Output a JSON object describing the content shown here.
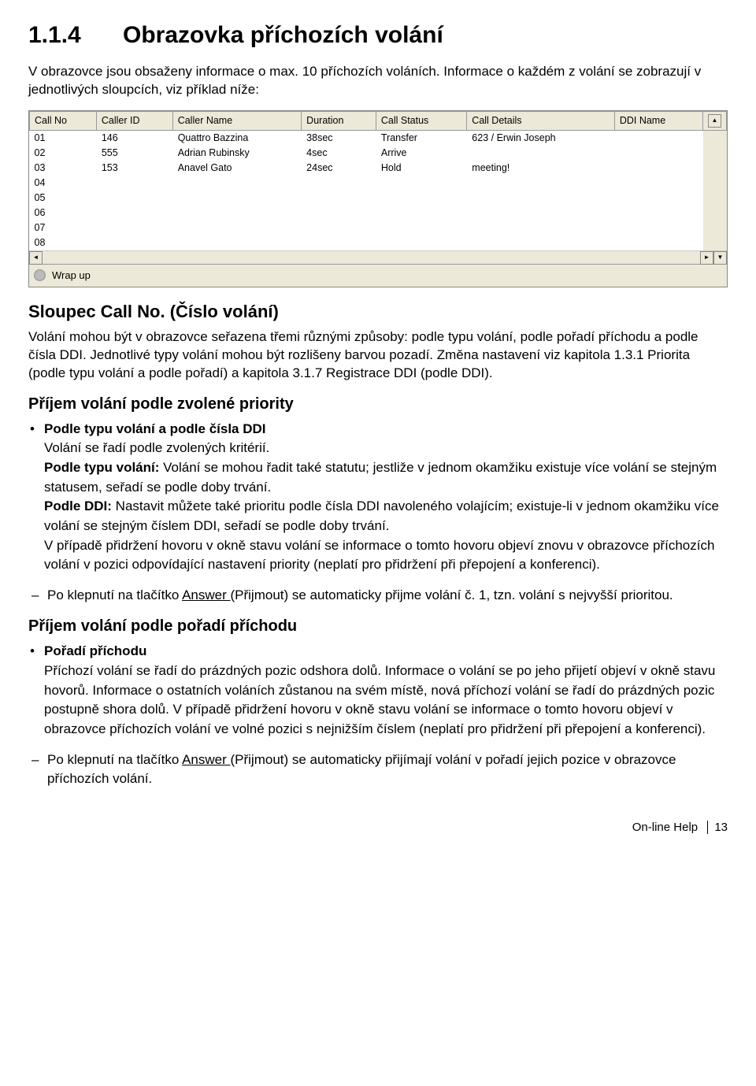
{
  "h1_num": "1.1.4",
  "h1_title": "Obrazovka příchozích volání",
  "intro": "V obrazovce jsou obsaženy informace o max. 10 příchozích voláních. Informace o každém z volání se zobrazují v jednotlivých sloupcích, viz příklad níže:",
  "table": {
    "headers": [
      "Call No",
      "Caller ID",
      "Caller Name",
      "Duration",
      "Call Status",
      "Call Details",
      "DDI Name"
    ],
    "rows": [
      {
        "no": "01",
        "id": "146",
        "name": "Quattro Bazzina",
        "dur": "38sec",
        "status": "Transfer",
        "details": "623 / Erwin Joseph",
        "ddi": ""
      },
      {
        "no": "02",
        "id": "555",
        "name": "Adrian Rubinsky",
        "dur": "4sec",
        "status": "Arrive",
        "details": "",
        "ddi": ""
      },
      {
        "no": "03",
        "id": "153",
        "name": "Anavel Gato",
        "dur": "24sec",
        "status": "Hold",
        "details": "meeting!",
        "ddi": ""
      },
      {
        "no": "04",
        "id": "",
        "name": "",
        "dur": "",
        "status": "",
        "details": "",
        "ddi": ""
      },
      {
        "no": "05",
        "id": "",
        "name": "",
        "dur": "",
        "status": "",
        "details": "",
        "ddi": ""
      },
      {
        "no": "06",
        "id": "",
        "name": "",
        "dur": "",
        "status": "",
        "details": "",
        "ddi": ""
      },
      {
        "no": "07",
        "id": "",
        "name": "",
        "dur": "",
        "status": "",
        "details": "",
        "ddi": ""
      },
      {
        "no": "08",
        "id": "",
        "name": "",
        "dur": "",
        "status": "",
        "details": "",
        "ddi": ""
      }
    ],
    "status_text": "Wrap up"
  },
  "sec1_title_a": "Sloupec Call No. ",
  "sec1_title_b": "(Číslo volání)",
  "sec1_body": "Volání mohou být v obrazovce seřazena třemi různými způsoby: podle typu volání, podle pořadí příchodu a podle čísla DDI. Jednotlivé typy volání mohou být rozlišeny barvou pozadí. Změna nastavení viz kapitola 1.3.1 Priorita (podle typu volání a podle pořadí) a kapitola 3.1.7 Registrace DDI (podle DDI).",
  "sec2_title": "Příjem volání podle zvolené priority",
  "sec2_b1_title": "Podle typu volání a podle čísla DDI",
  "sec2_b1_l1": "Volání se řadí podle zvolených kritérií.",
  "sec2_b1_l2a": "Podle typu volání:",
  "sec2_b1_l2b": " Volání se mohou řadit také statutu; jestliže v jednom okamžiku existuje více volání se stejným statusem, seřadí se podle doby trvání.",
  "sec2_b1_l3a": "Podle DDI:",
  "sec2_b1_l3b": " Nastavit můžete také prioritu podle čísla DDI navoleného volajícím; existuje-li v jednom okamžiku více volání se stejným číslem DDI, seřadí se podle doby trvání.",
  "sec2_b1_l4": "V případě přidržení hovoru v okně stavu volání se informace o tomto hovoru objeví znovu v obrazovce příchozích volání v pozici odpovídající nastavení priority (neplatí pro přidržení při přepojení a konferenci).",
  "sec2_d1_a": "Po klepnutí na tlačítko ",
  "sec2_d1_u": "Answer ",
  "sec2_d1_b": "(Přijmout) se automaticky přijme volání č. 1, tzn. volání s nejvyšší prioritou.",
  "sec3_title": "Příjem volání podle pořadí příchodu",
  "sec3_b1_title": "Pořadí příchodu",
  "sec3_b1_body": "Příchozí volání se řadí do prázdných pozic odshora dolů. Informace o volání se po jeho přijetí objeví v okně stavu hovorů. Informace o ostatních voláních zůstanou na svém místě, nová příchozí volání se řadí do prázdných pozic postupně shora dolů. V případě přidržení hovoru v okně stavu volání se informace o tomto hovoru objeví v obrazovce příchozích volání ve volné pozici s nejnižším číslem (neplatí pro přidržení při přepojení a konferenci).",
  "sec3_d1_a": "Po klepnutí na tlačítko ",
  "sec3_d1_u": "Answer ",
  "sec3_d1_b": "(Přijmout) se automaticky přijímají volání v pořadí jejich pozice v obrazovce příchozích volání.",
  "footer_label": "On-line Help",
  "footer_page": "13"
}
